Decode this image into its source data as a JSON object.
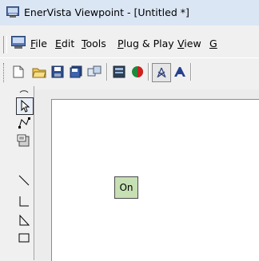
{
  "window": {
    "title": "EnerVista Viewpoint - [Untitled *]"
  },
  "menubar": {
    "items": [
      {
        "label": "File",
        "mnemonic": "F",
        "rest": "ile"
      },
      {
        "label": "Edit",
        "mnemonic": "E",
        "rest": "dit"
      },
      {
        "label": "Tools",
        "mnemonic": "T",
        "rest": "ools"
      },
      {
        "label": "Plug & Play",
        "mnemonic": "P",
        "rest": "lug & Play"
      },
      {
        "label": "View",
        "mnemonic": "V",
        "rest": "iew"
      }
    ]
  },
  "toolbar": {
    "buttons": [
      "new-document-icon",
      "open-folder-icon",
      "save-icon",
      "save-all-icon",
      "connect-icon",
      "screen-icon",
      "color-icon",
      "network-icon",
      "text-icon"
    ]
  },
  "tools": {
    "items": [
      "hand-icon",
      "pointer-icon",
      "polyline-icon",
      "properties-icon",
      "line-icon",
      "orthogonal-line-icon",
      "triangle-icon",
      "rectangle-icon"
    ]
  },
  "canvas": {
    "widget": {
      "label": "On",
      "color": "#c6e0b4"
    }
  }
}
